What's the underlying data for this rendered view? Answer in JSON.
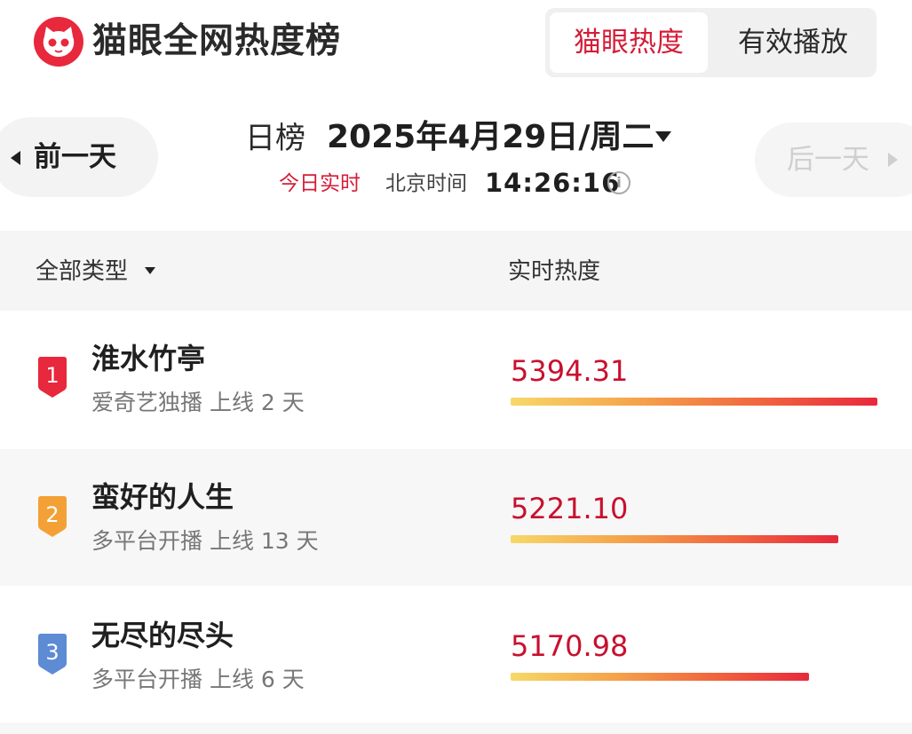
{
  "header": {
    "app_title": "猫眼全网热度榜",
    "logo_icon": "cat-logo-icon",
    "tabs": [
      {
        "label": "猫眼热度",
        "active": true
      },
      {
        "label": "有效播放",
        "active": false
      }
    ],
    "accent_color": "#d51d38"
  },
  "date_nav": {
    "prev_label": "前一天",
    "next_label": "后一天",
    "kind": "日榜",
    "date": "2025年4月29日/周二",
    "today_label": "今日实时",
    "beijing_label": "北京时间",
    "time": "14:26:16"
  },
  "table": {
    "col_type": "全部类型",
    "col_heat": "实时热度",
    "rows": [
      {
        "rank": "1",
        "title": "淮水竹亭",
        "sub": "爱奇艺独播 上线 2 天",
        "score": "5394.31",
        "badge_color": "#e8283c"
      },
      {
        "rank": "2",
        "title": "蛮好的人生",
        "sub": "多平台开播 上线 13 天",
        "score": "5221.10",
        "badge_color": "#f3a136"
      },
      {
        "rank": "3",
        "title": "无尽的尽头",
        "sub": "多平台开播 上线 6 天",
        "score": "5170.98",
        "badge_color": "#5d8bd4"
      }
    ]
  }
}
